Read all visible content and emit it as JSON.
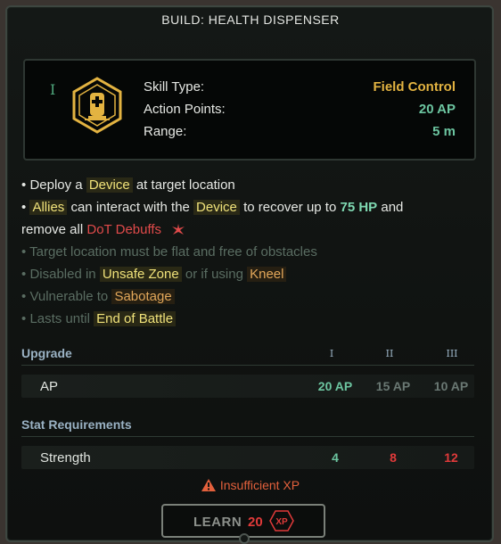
{
  "title": "BUILD: HEALTH DISPENSER",
  "rank_numeral": "I",
  "skill_icon": "health-dispenser-icon",
  "info": [
    {
      "label": "Skill Type:",
      "value": "Field Control",
      "color": "#e3b341"
    },
    {
      "label": "Action Points:",
      "value": "20 AP",
      "color": "#6cc5a0"
    },
    {
      "label": "Range:",
      "value": "5 m",
      "color": "#6cc5a0"
    }
  ],
  "description": {
    "line1": {
      "bullet": "•",
      "pre": "Deploy a",
      "kw": "Device",
      "post": "at target location"
    },
    "line2": {
      "bullet": "•",
      "kw1": "Allies",
      "mid1": "can interact with the",
      "kw2": "Device",
      "mid2": "to recover up to",
      "kw3": "75 HP",
      "post": "and"
    },
    "line3": {
      "pre": "remove all",
      "kw": "DoT Debuffs"
    },
    "line4": {
      "bullet": "•",
      "text": "Target location must be flat and free of obstacles"
    },
    "line5": {
      "bullet": "•",
      "pre": "Disabled in",
      "kw1": "Unsafe Zone",
      "mid": "or if using",
      "kw2": "Kneel"
    },
    "line6": {
      "bullet": "•",
      "pre": "Vulnerable to",
      "kw": "Sabotage"
    },
    "line7": {
      "bullet": "•",
      "pre": "Lasts until",
      "kw": "End of Battle"
    }
  },
  "upgrade": {
    "heading": "Upgrade",
    "tiers": [
      "I",
      "II",
      "III"
    ],
    "row_label": "AP",
    "values": [
      "20 AP",
      "15 AP",
      "10 AP"
    ]
  },
  "requirements": {
    "heading": "Stat Requirements",
    "row_label": "Strength",
    "values": [
      "4",
      "8",
      "12"
    ]
  },
  "warning": "Insufficient XP",
  "learn": {
    "label": "LEARN",
    "cost": "20",
    "xp_label": "XP"
  },
  "colors": {
    "accent_gold": "#e3b341",
    "accent_teal": "#6cc5a0",
    "warning": "#e2603c",
    "error_red": "#e03a3a"
  }
}
